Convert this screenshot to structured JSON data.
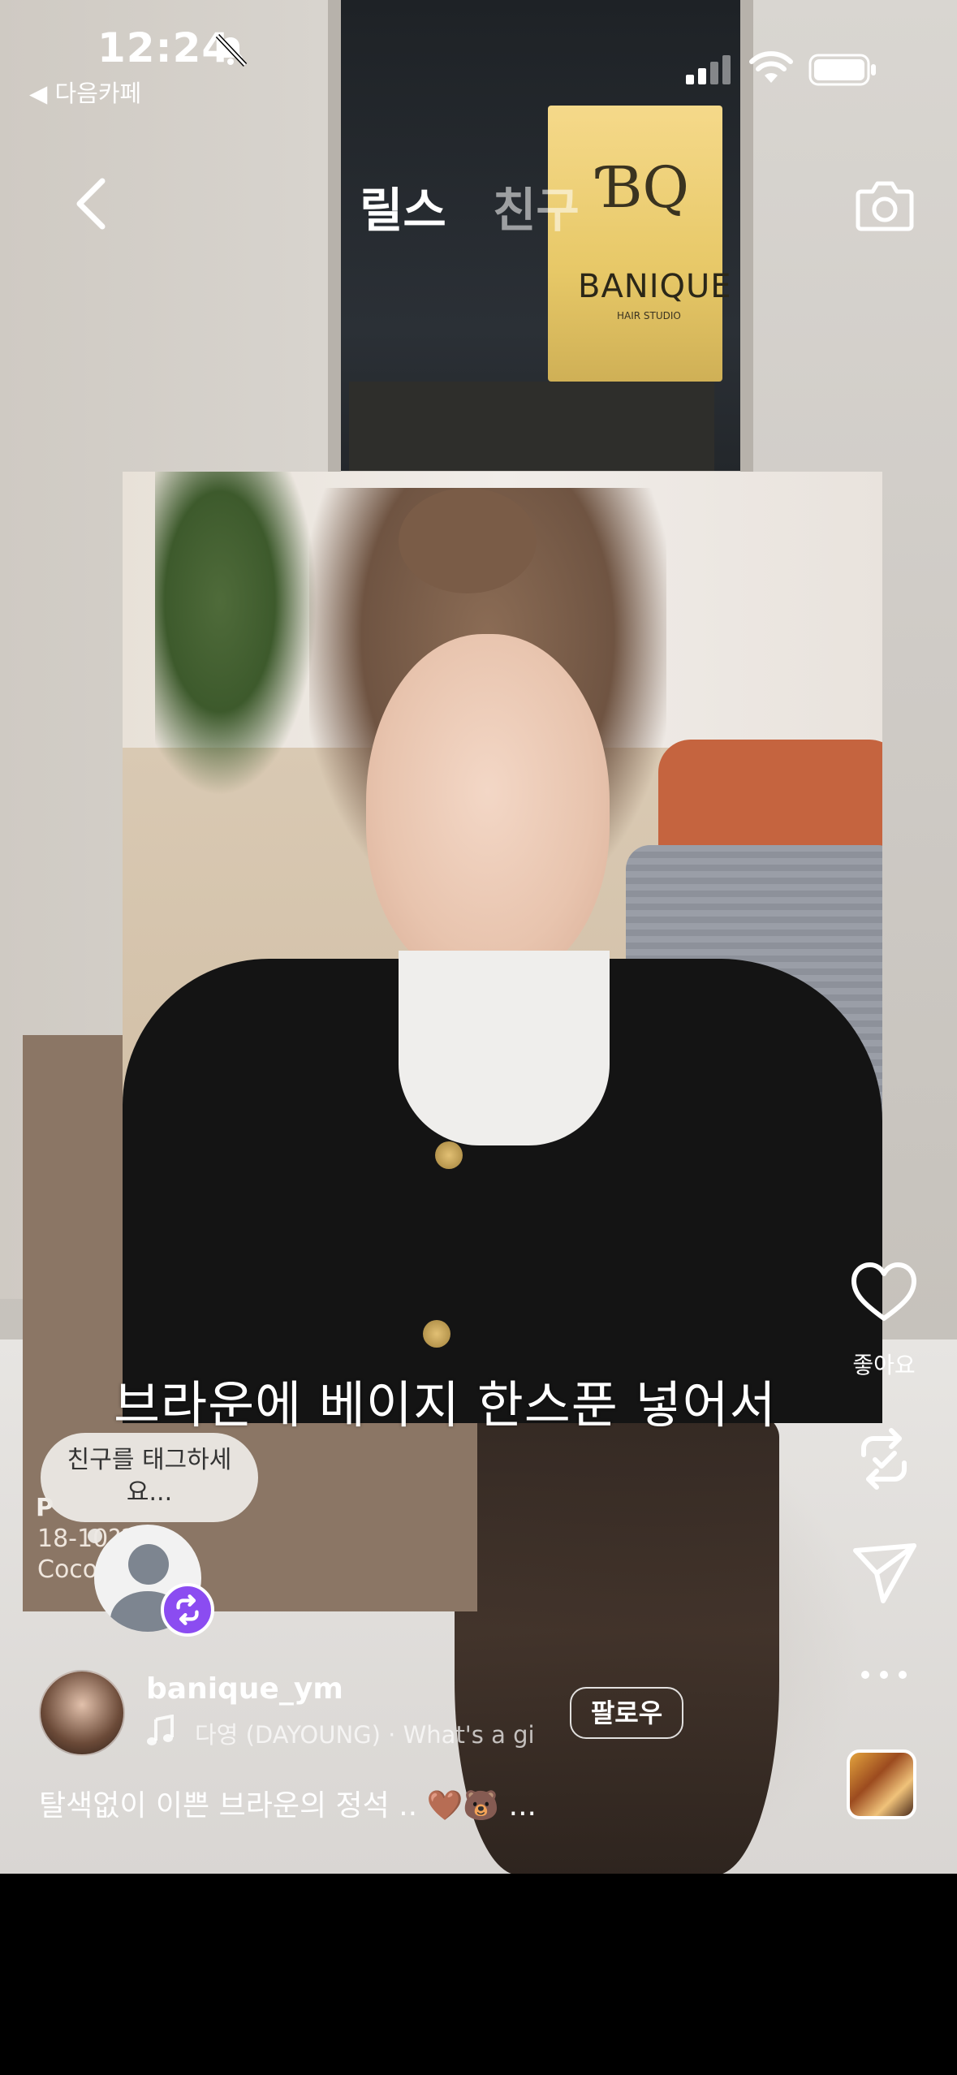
{
  "status_bar": {
    "time": "12:24",
    "back_app": "◀ 다음카페"
  },
  "header": {
    "tab_reels": "릴스",
    "tab_friends": "친구"
  },
  "background_sign": {
    "brand": "BANIQUE",
    "sub": "HAIR STUDIO"
  },
  "swatch": {
    "line1": "P",
    "line2": "18-10?? X",
    "line3": "Coco"
  },
  "overlay_caption": "브라운에 베이지 한스푼 넣어서",
  "actions": {
    "like_label": "좋아요"
  },
  "tag_bubble": "친구를 태그하세요...",
  "post": {
    "username": "banique_ym",
    "audio": "다영 (DAYOUNG) · What's a gi",
    "follow_label": "팔로우",
    "caption": "탈색없이 이쁜 브라운의 정석 .. 🤎🐻 ..."
  },
  "icons": [
    "bell-slash-icon",
    "signal-icon",
    "wifi-icon",
    "battery-icon",
    "back-icon",
    "camera-icon",
    "heart-icon",
    "remix-icon",
    "send-icon",
    "more-icon",
    "music-icon"
  ]
}
